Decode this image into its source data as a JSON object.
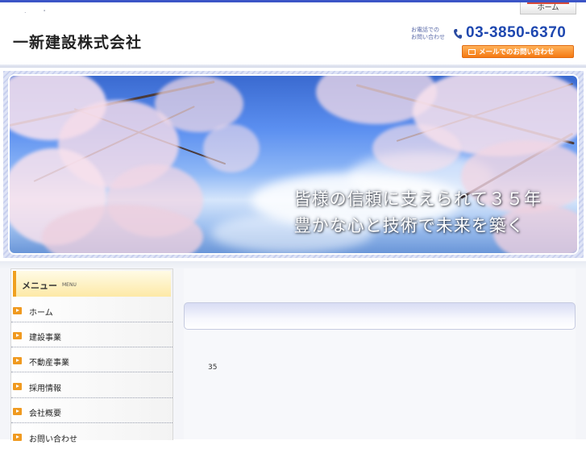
{
  "header": {
    "tiny_marks": ". ・",
    "home_tab_label": "ホーム",
    "company_name": "一新建設株式会社",
    "phone_caption": "お電話での\nお問い合わせ",
    "phone_number": "03-3850-6370",
    "mail_button_label": "メールでのお問い合わせ"
  },
  "hero": {
    "line1": "皆様の信頼に支えられて３５年",
    "line2": "豊かな心と技術で未来を築く"
  },
  "sidebar": {
    "title": "メニュー",
    "subtitle": "MENU",
    "items": [
      {
        "label": "ホーム"
      },
      {
        "label": "建設事業"
      },
      {
        "label": "不動産事業"
      },
      {
        "label": "採用情報"
      },
      {
        "label": "会社概要"
      },
      {
        "label": "お問い合わせ"
      }
    ]
  },
  "content": {
    "heading": "",
    "text": "35"
  },
  "colors": {
    "top_bar": "#3b55c7",
    "phone_number": "#1f48b0",
    "mail_button": "#f57a13",
    "menu_arrow": "#f09a20"
  },
  "icons": [
    "phone-icon",
    "mail-icon",
    "arrow-right-icon"
  ]
}
